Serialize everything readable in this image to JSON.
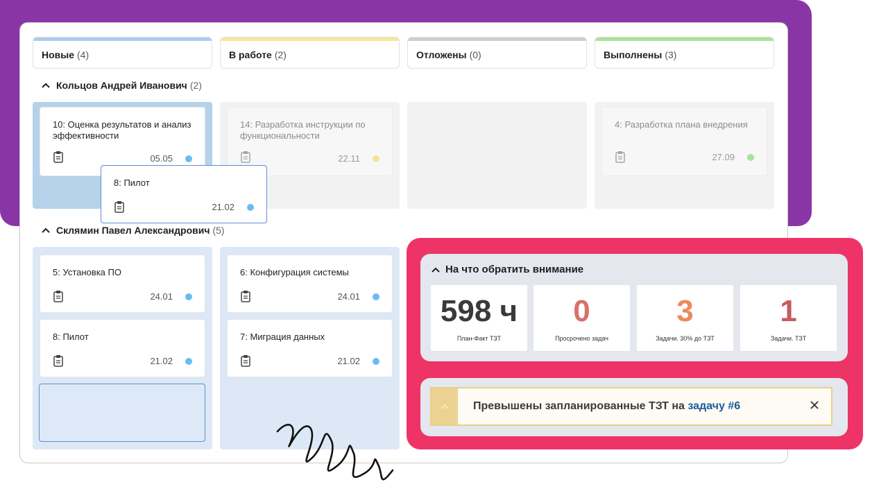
{
  "columns": [
    {
      "title": "Новые",
      "count": "(4)",
      "color": "#a9cdef"
    },
    {
      "title": "В работе",
      "count": "(2)",
      "color": "#f6e79a"
    },
    {
      "title": "Отложены",
      "count": "(0)",
      "color": "#cfcfcf"
    },
    {
      "title": "Выполнены",
      "count": "(3)",
      "color": "#a9e29a"
    }
  ],
  "groups": [
    {
      "name": "Кольцов Андрей Иванович",
      "count": "(2)",
      "cards": {
        "new": {
          "title": "10: Оценка результатов и анализ эффективности",
          "date": "05.05",
          "dot": "#6bbcf0"
        },
        "in_progress": {
          "title": "14: Разработка инструкции по функциональности",
          "date": "22.11",
          "dot": "#f4e49a"
        },
        "done": {
          "title": "4: Разработка плана внедрения",
          "date": "27.09",
          "dot": "#a8e0a0"
        }
      }
    },
    {
      "name": "Склямин Павел Александрович",
      "count": "(5)",
      "cards": {
        "new_1": {
          "title": "5: Установка ПО",
          "date": "24.01",
          "dot": "#6bbcf0"
        },
        "new_2": {
          "title": "8: Пилот",
          "date": "21.02",
          "dot": "#6bbcf0"
        },
        "in_progress_1": {
          "title": "6: Конфигурация системы",
          "date": "24.01",
          "dot": "#6bbcf0"
        },
        "in_progress_2": {
          "title": "7: Миграция данных",
          "date": "21.02",
          "dot": "#6bbcf0"
        }
      }
    }
  ],
  "drag_card": {
    "title": "8: Пилот",
    "date": "21.02",
    "dot": "#6bbcf0"
  },
  "attention": {
    "title": "На что обратить внимание",
    "metrics": [
      {
        "value": "598 ч",
        "label": "План-Факт ТЗТ",
        "color": "#3a3a3a"
      },
      {
        "value": "0",
        "label": "Просрочено задач",
        "color": "#d9706b"
      },
      {
        "value": "3",
        "label": "Задачи. 30% до ТЗТ",
        "color": "#ee8a5a"
      },
      {
        "value": "1",
        "label": "Задачи. ТЗТ",
        "color": "#c65a5f"
      }
    ]
  },
  "alert": {
    "text": "Превышены запланированные ТЗТ на ",
    "link": "задачу #6"
  },
  "colors": {
    "accent_purple": "#8a35a6",
    "accent_pink": "#ee3366",
    "lane_blue": "#dce8f5",
    "lane_blue_active": "#b6d2ea",
    "lane_gray": "#f2f2f2"
  }
}
